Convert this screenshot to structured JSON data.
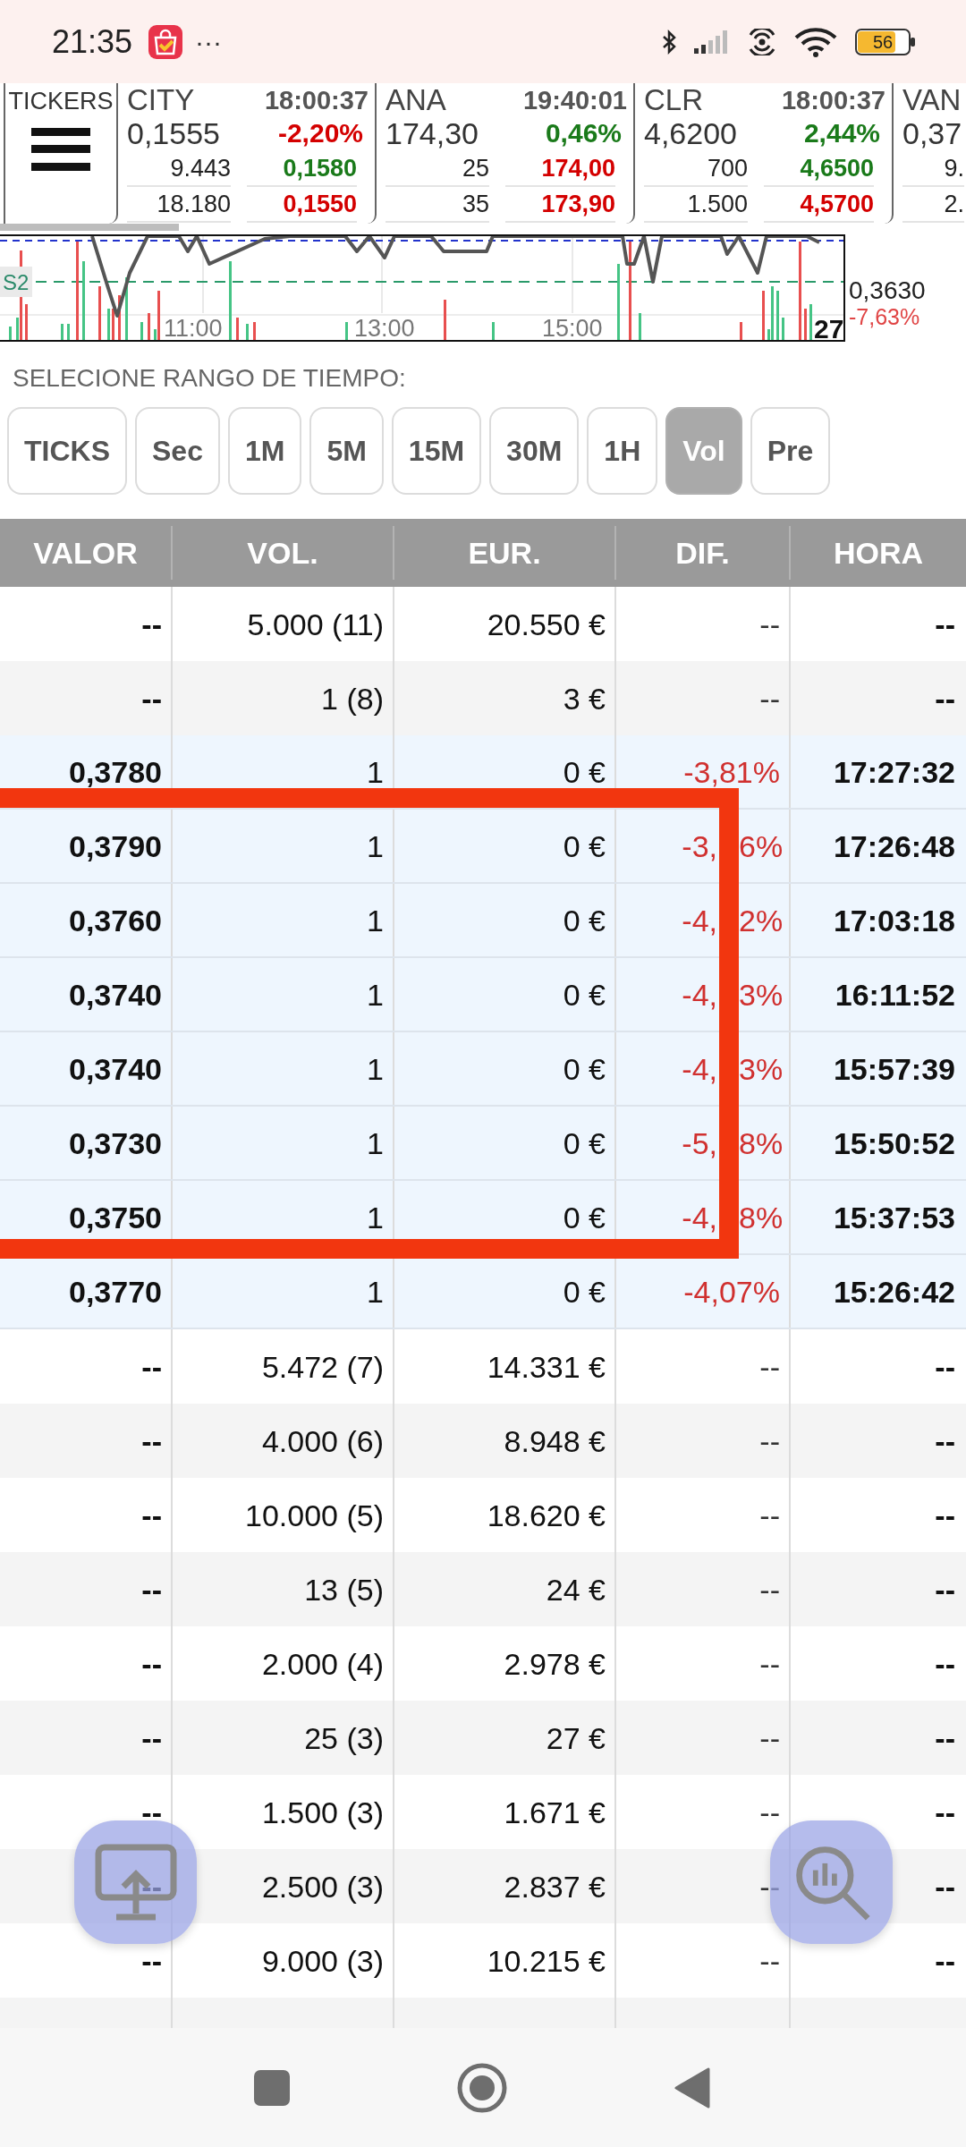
{
  "status_bar": {
    "time": "21:35",
    "more": "···",
    "battery": "56"
  },
  "tickers_menu": {
    "label": "TICKERS"
  },
  "tickers": [
    {
      "name": "CITY",
      "time": "18:00:37",
      "price": "0,1555",
      "change": {
        "text": "-2,20%",
        "color": "#d40000"
      },
      "quotes": [
        {
          "size": "9.443",
          "price": "0,1580",
          "color": "#1a7a1a"
        },
        {
          "size": "18.180",
          "price": "0,1550",
          "color": "#d40000"
        }
      ]
    },
    {
      "name": "ANA",
      "time": "19:40:01",
      "price": "174,30",
      "change": {
        "text": "0,46%",
        "color": "#1a7a1a"
      },
      "quotes": [
        {
          "size": "25",
          "price": "174,00",
          "color": "#d40000"
        },
        {
          "size": "35",
          "price": "173,90",
          "color": "#d40000"
        }
      ]
    },
    {
      "name": "CLR",
      "time": "18:00:37",
      "price": "4,6200",
      "change": {
        "text": "2,44%",
        "color": "#1a7a1a"
      },
      "quotes": [
        {
          "size": "700",
          "price": "4,6500",
          "color": "#1a7a1a"
        },
        {
          "size": "1.500",
          "price": "4,5700",
          "color": "#d40000"
        }
      ]
    },
    {
      "name": "VAN",
      "price": "0,37",
      "quotes": [
        {
          "size": "9."
        },
        {
          "size": "2."
        }
      ]
    }
  ],
  "chart": {
    "level_label": "S2",
    "time_labels": [
      "11:00",
      "13:00",
      "15:00"
    ],
    "volume_label": "27",
    "last_price": "0,3630",
    "change": "-7,63%"
  },
  "range": {
    "label": "SELECIONE RANGO DE TIEMPO:",
    "options": [
      {
        "label": "TICKS",
        "selected": false
      },
      {
        "label": "Sec",
        "selected": false
      },
      {
        "label": "1M",
        "selected": false
      },
      {
        "label": "5M",
        "selected": false
      },
      {
        "label": "15M",
        "selected": false
      },
      {
        "label": "30M",
        "selected": false
      },
      {
        "label": "1H",
        "selected": false
      },
      {
        "label": "Vol",
        "selected": true
      },
      {
        "label": "Pre",
        "selected": false
      }
    ]
  },
  "table": {
    "columns": [
      "VALOR",
      "VOL.",
      "EUR.",
      "DIF.",
      "HORA"
    ],
    "rows": [
      {
        "kind": "summary",
        "valor": "--",
        "vol": "5.000 (11)",
        "eur": "20.550 €",
        "dif": [
          "--"
        ],
        "hora": "--"
      },
      {
        "kind": "summary",
        "valor": "--",
        "vol": "1 (8)",
        "eur": "3 €",
        "dif": [
          "--"
        ],
        "hora": "--"
      },
      {
        "kind": "trade",
        "valor": "0,3780",
        "vol": "1",
        "eur": "0 €",
        "dif": [
          "-3,81%"
        ],
        "hora": "17:27:32"
      },
      {
        "kind": "highlight",
        "color": "#f2360f",
        "rows": [
          {
            "kind": "trade",
            "valor": "0,3790",
            "vol": "1",
            "eur": "0 €",
            "dif": [
              "-3,",
              "6%"
            ],
            "hora": "17:26:48"
          },
          {
            "kind": "trade",
            "valor": "0,3760",
            "vol": "1",
            "eur": "0 €",
            "dif": [
              "-4,",
              "2%"
            ],
            "hora": "17:03:18"
          },
          {
            "kind": "trade",
            "valor": "0,3740",
            "vol": "1",
            "eur": "0 €",
            "dif": [
              "-4,",
              "3%"
            ],
            "hora": "16:11:52"
          },
          {
            "kind": "trade",
            "valor": "0,3740",
            "vol": "1",
            "eur": "0 €",
            "dif": [
              "-4,",
              "3%"
            ],
            "hora": "15:57:39"
          },
          {
            "kind": "trade",
            "valor": "0,3730",
            "vol": "1",
            "eur": "0 €",
            "dif": [
              "-5,",
              "8%"
            ],
            "hora": "15:50:52"
          },
          {
            "kind": "trade",
            "valor": "0,3750",
            "vol": "1",
            "eur": "0 €",
            "dif": [
              "-4,",
              "8%"
            ],
            "hora": "15:37:53"
          }
        ]
      },
      {
        "kind": "trade",
        "valor": "0,3770",
        "vol": "1",
        "eur": "0 €",
        "dif": [
          "-4,07%"
        ],
        "hora": "15:26:42"
      },
      {
        "kind": "summary",
        "valor": "--",
        "vol": "5.472 (7)",
        "eur": "14.331 €",
        "dif": [
          "--"
        ],
        "hora": "--"
      },
      {
        "kind": "summary",
        "valor": "--",
        "vol": "4.000 (6)",
        "eur": "8.948 €",
        "dif": [
          "--"
        ],
        "hora": "--"
      },
      {
        "kind": "summary",
        "valor": "--",
        "vol": "10.000 (5)",
        "eur": "18.620 €",
        "dif": [
          "--"
        ],
        "hora": "--"
      },
      {
        "kind": "summary",
        "valor": "--",
        "vol": "13 (5)",
        "eur": "24 €",
        "dif": [
          "--"
        ],
        "hora": "--"
      },
      {
        "kind": "summary",
        "valor": "--",
        "vol": "2.000 (4)",
        "eur": "2.978 €",
        "dif": [
          "--"
        ],
        "hora": "--"
      },
      {
        "kind": "summary",
        "valor": "--",
        "vol": "25 (3)",
        "eur": "27 €",
        "dif": [
          "--"
        ],
        "hora": "--"
      },
      {
        "kind": "summary",
        "valor": "--",
        "vol": "1.500 (3)",
        "eur": "1.671 €",
        "dif": [
          "--"
        ],
        "hora": "--"
      },
      {
        "kind": "summary",
        "valor": "--",
        "vol": "2.500 (3)",
        "eur": "2.837 €",
        "dif": [
          "--"
        ],
        "hora": "--"
      },
      {
        "kind": "summary",
        "valor": "--",
        "vol": "9.000 (3)",
        "eur": "10.215 €",
        "dif": [
          "--"
        ],
        "hora": "--"
      }
    ]
  }
}
